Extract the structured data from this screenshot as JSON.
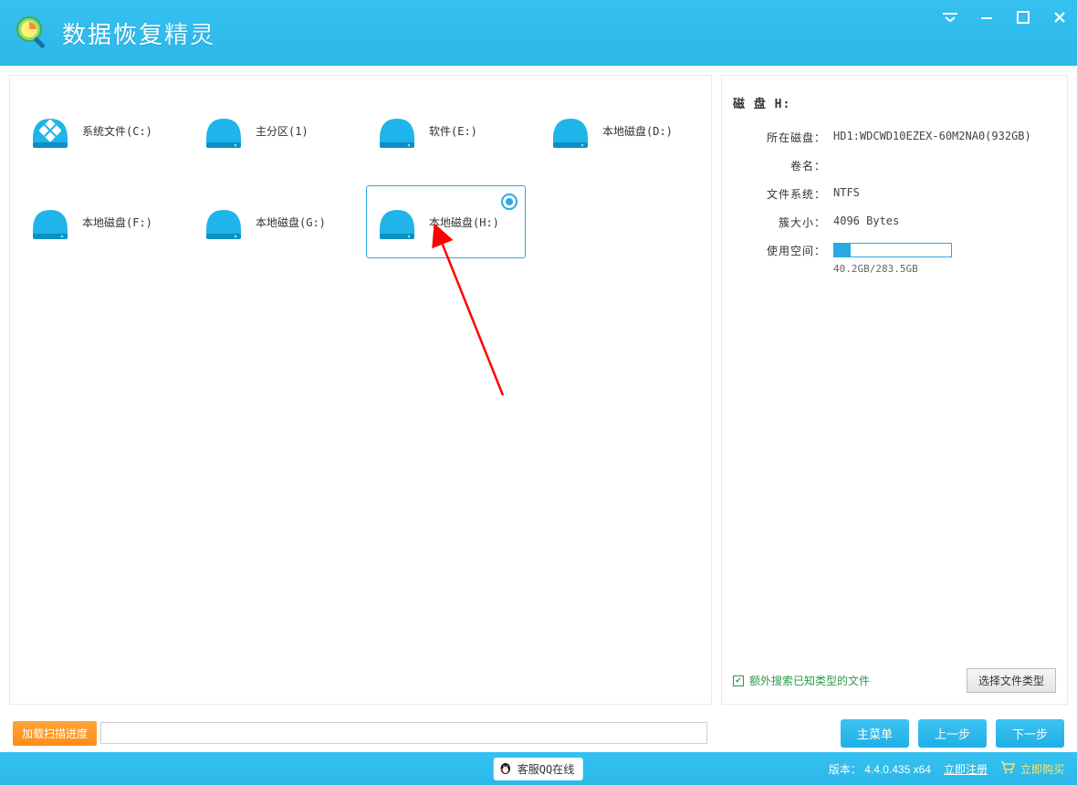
{
  "app": {
    "title_main": "数据恢复",
    "title_accent": "精灵"
  },
  "drives": [
    {
      "label": "系统文件(C:)",
      "special": true
    },
    {
      "label": "主分区(1)"
    },
    {
      "label": "软件(E:)"
    },
    {
      "label": "本地磁盘(D:)"
    },
    {
      "label": "本地磁盘(F:)"
    },
    {
      "label": "本地磁盘(G:)"
    },
    {
      "label": "本地磁盘(H:)",
      "selected": true
    }
  ],
  "info": {
    "title": "磁 盘 H:",
    "rows": {
      "disk_label": "所在磁盘：",
      "disk_value": "HD1:WDCWD10EZEX-60M2NA0(932GB)",
      "volname_label": "卷名：",
      "volname_value": "",
      "fs_label": "文件系统：",
      "fs_value": "NTFS",
      "cluster_label": "簇大小：",
      "cluster_value": "4096 Bytes",
      "usage_label": "使用空间：",
      "usage_text": "40.2GB/283.5GB",
      "usage_percent": 14
    },
    "checkbox_label": "额外搜索已知类型的文件",
    "select_types_btn": "选择文件类型"
  },
  "bottom": {
    "load_progress": "加载扫描进度",
    "main_menu": "主菜单",
    "prev": "上一步",
    "next": "下一步"
  },
  "status": {
    "qq": "客服QQ在线",
    "version_label": "版本：",
    "version": "4.4.0.435 x64",
    "register": "立即注册",
    "buy": "立即购买"
  }
}
